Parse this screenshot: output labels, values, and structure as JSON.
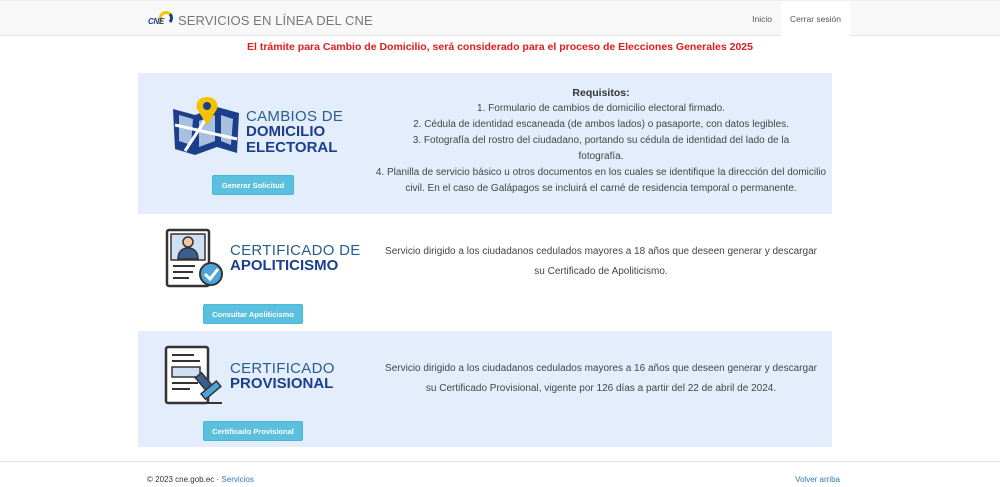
{
  "nav": {
    "brand_logo_text": "CNE",
    "brand_title": "SERVICIOS EN LÍNEA DEL CNE",
    "home": "Inicio",
    "logout": "Cerrar sesión"
  },
  "notice": "El trámite para Cambio de Domicilio, será considerado para el proceso de Elecciones Generales 2025",
  "services": [
    {
      "title_line1": "CAMBIOS DE",
      "title_line2": "DOMICILIO",
      "title_line3": "ELECTORAL",
      "button": "Generar Solicitud",
      "requirements_title": "Requisitos:",
      "requirements": [
        "1. Formulario de cambios de domicilio electoral firmado.",
        "2. Cédula de identidad escaneada (de ambos lados) o pasaporte, con datos legibles.",
        "3. Fotografía del rostro del ciudadano, portando su cédula de identidad del lado de la fotografía.",
        "4. Planilla de servicio básico u otros documentos en los cuales se identifique la dirección del domicilio civil. En el caso de Galápagos se incluirá el carné de residencia temporal o permanente."
      ]
    },
    {
      "title_line1": "CERTIFICADO DE",
      "title_line2": "APOLITICISMO",
      "button": "Consultar Apoliticismo",
      "description": "Servicio dirigido a los ciudadanos cedulados mayores a 18 años que deseen generar y descargar su Certificado de Apoliticismo."
    },
    {
      "title_line1": "CERTIFICADO",
      "title_line2": "PROVISIONAL",
      "button": "Certificado Provisional",
      "description": "Servicio dirigido a los ciudadanos cedulados mayores a 16 años que deseen generar y descargar su Certificado Provisional, vigente por 126 días a partir del 22 de abril de 2024."
    }
  ],
  "footer": {
    "copyright": "© 2023 cne.gob.ec",
    "separator": "·",
    "services_link": "Servicios",
    "back_to_top": "Volver arriba"
  },
  "colors": {
    "accent": "#5bc0de",
    "panel_bg": "#e3edfc",
    "brand_blue": "#1b3f8b",
    "notice_red": "#e01b1b"
  }
}
